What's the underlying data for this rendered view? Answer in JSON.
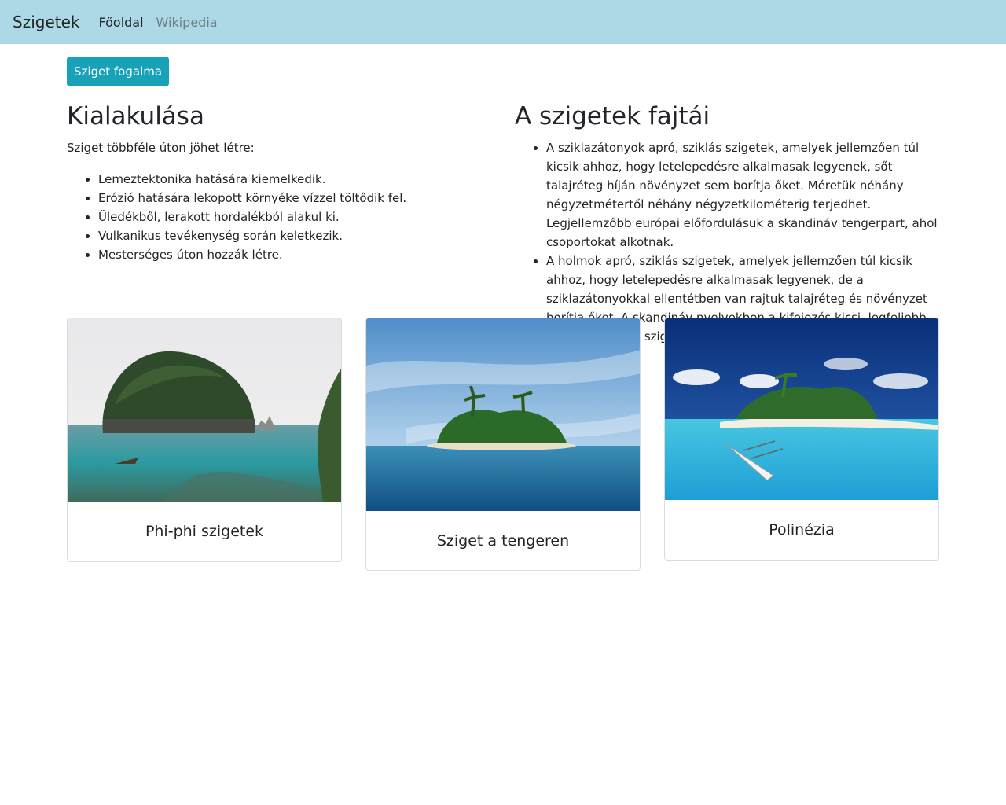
{
  "navbar": {
    "brand": "Szigetek",
    "links": [
      {
        "label": "Főoldal",
        "active": true
      },
      {
        "label": "Wikipedia",
        "active": false
      }
    ],
    "background": "#add8e6"
  },
  "button": {
    "label": "Sziget fogalma",
    "color": "#17a2b8"
  },
  "left": {
    "heading": "Kialakulása",
    "intro": "Sziget többféle úton jöhet létre:",
    "items": [
      "Lemeztektonika hatására kiemelkedik.",
      "Erózió hatására lekopott környéke vízzel töltődik fel.",
      "Üledékből, lerakott hordalékból alakul ki.",
      "Vulkanikus tevékenység során keletkezik.",
      "Mesterséges úton hozzák létre."
    ]
  },
  "right": {
    "heading": "A szigetek fajtái",
    "items": [
      "A sziklazátonyok apró, sziklás szigetek, amelyek jellemzően túl kicsik ahhoz, hogy letelepedésre alkalmasak legyenek, sőt talajréteg híján növényzet sem borítja őket. Méretük néhány négyzetmétertől néhány négyzetkilométerig terjedhet. Legjellemzőbb európai előfordulásuk a skandináv tengerpart, ahol csoportokat alkotnak.",
      "A holmok apró, sziklás szigetek, amelyek jellemzően túl kicsik ahhoz, hogy letelepedésre alkalmasak legyenek, de a sziklazátonyokkal ellentétben van rajtuk talajréteg és növényzet borítja őket. A skandináv nyelvekben a kifejezés kicsi, legfeljebb közepes méretű szigetet jelent."
    ]
  },
  "cards": [
    {
      "title": "Phi-phi szigetek"
    },
    {
      "title": "Sziget a tengeren"
    },
    {
      "title": "Polinézia"
    }
  ]
}
